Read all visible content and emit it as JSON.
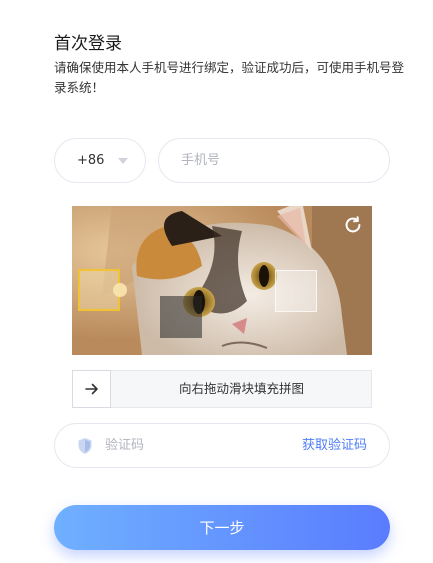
{
  "header": {
    "title": "首次登录",
    "subtitle": "请确保使用本人手机号进行绑定，验证成功后，可使用手机号登录系统！"
  },
  "phone": {
    "country_code": "+86",
    "placeholder": "手机号"
  },
  "captcha": {
    "image": "cat-photo",
    "refresh_icon": "refresh-icon",
    "slider_icon": "arrow-right-icon",
    "hint": "向右拖动滑块填充拼图",
    "piece_color": "#f1c232"
  },
  "verification": {
    "icon": "shield-icon",
    "placeholder": "验证码",
    "get_code_label": "获取验证码",
    "link_color": "#4d7cf5"
  },
  "next_button": {
    "label": "下一步",
    "gradient": [
      "#6fb0ff",
      "#5a7cff"
    ]
  }
}
